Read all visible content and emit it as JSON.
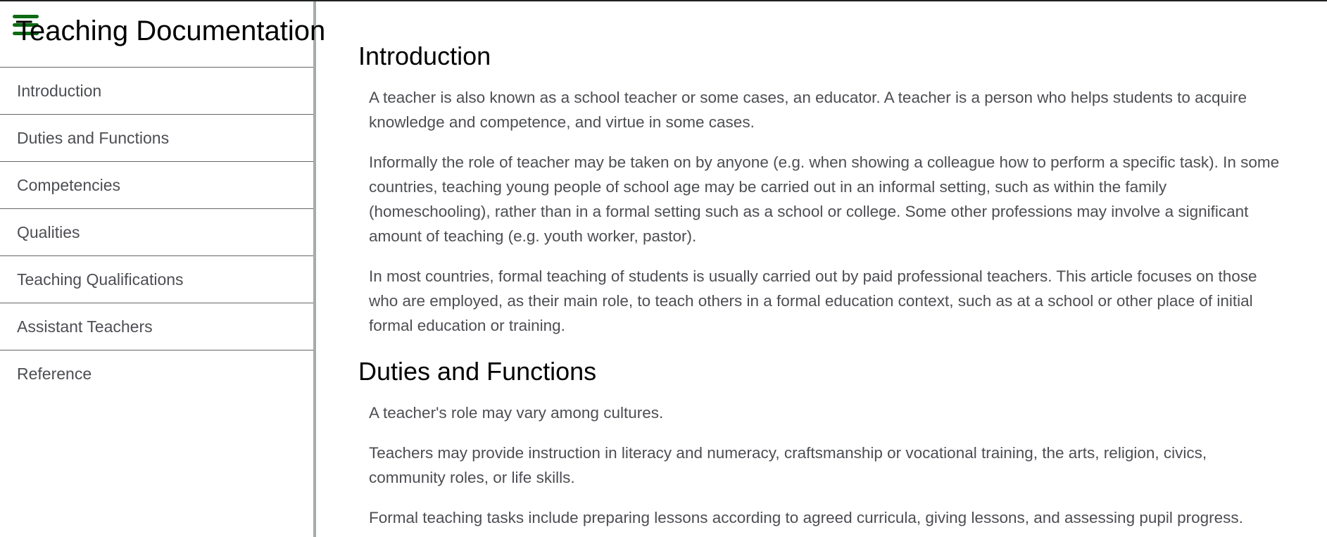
{
  "navbar": {
    "title": "Teaching Documentation",
    "items": [
      {
        "label": "Introduction"
      },
      {
        "label": "Duties and Functions"
      },
      {
        "label": "Competencies"
      },
      {
        "label": "Qualities"
      },
      {
        "label": "Teaching Qualifications"
      },
      {
        "label": "Assistant Teachers"
      },
      {
        "label": "Reference"
      }
    ]
  },
  "main": {
    "sections": [
      {
        "heading": "Introduction",
        "paragraphs": [
          "A teacher is also known as a school teacher or some cases, an educator. A teacher is a person who helps students to acquire knowledge and competence, and virtue in some cases.",
          "Informally the role of teacher may be taken on by anyone (e.g. when showing a colleague how to perform a specific task). In some countries, teaching young people of school age may be carried out in an informal setting, such as within the family (homeschooling), rather than in a formal setting such as a school or college. Some other professions may involve a significant amount of teaching (e.g. youth worker, pastor).",
          "In most countries, formal teaching of students is usually carried out by paid professional teachers. This article focuses on those who are employed, as their main role, to teach others in a formal education context, such as at a school or other place of initial formal education or training."
        ]
      },
      {
        "heading": "Duties and Functions",
        "paragraphs": [
          "A teacher's role may vary among cultures.",
          "Teachers may provide instruction in literacy and numeracy, craftsmanship or vocational training, the arts, religion, civics, community roles, or life skills.",
          "Formal teaching tasks include preparing lessons according to agreed curricula, giving lessons, and assessing pupil progress."
        ]
      }
    ]
  },
  "colors": {
    "menu_icon": "#0d6b14",
    "body_text": "#4d4e53",
    "nav_border": "#a5abab"
  },
  "icons": {
    "menu": "hamburger-menu-icon"
  }
}
